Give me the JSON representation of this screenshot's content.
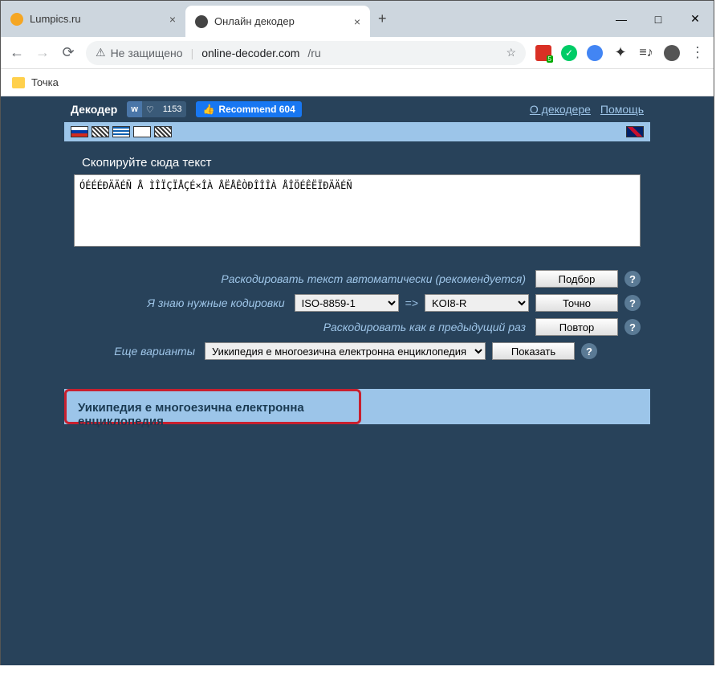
{
  "window": {
    "tabs": [
      {
        "title": "Lumpics.ru",
        "active": false
      },
      {
        "title": "Онлайн декодер",
        "active": true
      }
    ],
    "newtab": "+",
    "controls": {
      "min": "—",
      "max": "□",
      "close": "✕"
    }
  },
  "navbar": {
    "insecure_label": "Не защищено",
    "url_host": "online-decoder.com",
    "url_path": "/ru",
    "star": "☆"
  },
  "bookmarks": {
    "item1": "Точка"
  },
  "topbar": {
    "brand": "Декодер",
    "vk": {
      "logo": "w",
      "heart": "♡",
      "count": "1153"
    },
    "fb": {
      "label": "Recommend 604"
    },
    "link_about": "О декодере",
    "link_help": "Помощь"
  },
  "main": {
    "tab_label": "Скопируйте сюда текст",
    "textarea_value": "ÓÉÉÉÐÄÄÉÑ Å ÌÎÏÇÏÅÇÉ×ÎÀ ÅËÅÊÒÐÎÎÎÀ ÅÎÖÉÊËÏÐÄÄÉÑ",
    "opts": {
      "auto_label": "Раскодировать текст автоматически (рекомендуется)",
      "know_label": "Я знаю нужные кодировки",
      "repeat_label": "Раскодировать как в предыдущий раз",
      "more_label": "Еще варианты",
      "sel_from": "ISO-8859-1",
      "sel_to": "KOI8-R",
      "sel_variant": "Уикипедия е многоезична електронна енциклопедия",
      "btn_auto": "Подбор",
      "btn_exact": "Точно",
      "btn_repeat": "Повтор",
      "btn_show": "Показать",
      "arrow": "=>",
      "help": "?"
    }
  },
  "result": {
    "text": "Уикипедия е многоезична електронна енциклопедия"
  }
}
